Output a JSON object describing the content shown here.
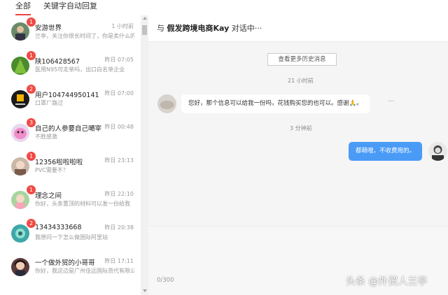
{
  "tabs": [
    {
      "label": "全部"
    },
    {
      "label": "关键字自动回复"
    }
  ],
  "conversations": [
    {
      "name": "安游世界",
      "time": "1 小时前",
      "preview": "兰亭，关注你很长时间了，你是卖什么的",
      "badge": "1"
    },
    {
      "name": "陕106428567",
      "time": "昨日 07:05",
      "preview": "医用N95可走单吗，出口白名单企业",
      "badge": "1"
    },
    {
      "name": "用户104744950141",
      "time": "昨日 07:00",
      "preview": "口罩厂路过",
      "badge": "2"
    },
    {
      "name": "自己的人参要自己嗮宰",
      "time": "昨日 00:48",
      "preview": "不胜感激",
      "badge": "3"
    },
    {
      "name": "12356啦啦啦啦",
      "time": "昨日 23:13",
      "preview": "PVC需要不？",
      "badge": "1"
    },
    {
      "name": "理念之间",
      "time": "昨日 22:10",
      "preview": "你好，头条置顶的材料可以发一份给我",
      "badge": "1"
    },
    {
      "name": "13434333668",
      "time": "昨日 20:38",
      "preview": "我想问一下怎么做国际阿里站",
      "badge": "2"
    },
    {
      "name": "一个做外贸的小哥哥",
      "time": "昨日 17:11",
      "preview": "你好，我这边是广州佳远国际货代有限公司",
      "badge": ""
    }
  ],
  "chat": {
    "header_prefix": "与",
    "contact": "假发跨境电商Kay",
    "header_suffix": "对话中···",
    "history_button": "查看更多历史消息",
    "timestamp_1": "21 小时前",
    "incoming_message": "您好，那个信息可以给我一份吗，花钱购买您的也可以。感谢🙏。",
    "more_dots": "···",
    "timestamp_2": "3 分钟前",
    "outgoing_message": "都萌哦，不收费用的。",
    "char_counter": "0/300"
  },
  "watermark": "头条 @外贸人兰亭",
  "colors": {
    "accent_red": "#f04a45",
    "outgoing_bubble": "#4a9bf6",
    "chat_bg": "#f5f5f5"
  }
}
